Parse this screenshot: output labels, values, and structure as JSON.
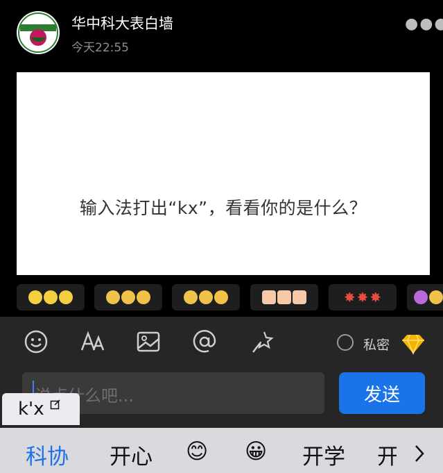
{
  "post": {
    "author": "华中科大表白墙",
    "time": "今天22:55",
    "image_text": "输入法打出“kx”，看看你的是什么？"
  },
  "reactions": [
    {
      "name": "lemon-emoji",
      "color": "#f4d03f"
    },
    {
      "name": "dizzy-face-emoji",
      "color": "#f0c24a"
    },
    {
      "name": "worried-face-emoji",
      "color": "#f0c24a"
    },
    {
      "name": "thumbs-up-emoji",
      "color": "#f6c9a8"
    },
    {
      "name": "firework-emoji",
      "color": "#e74c3c"
    },
    {
      "name": "party-emoji",
      "color": "#b96ad9"
    }
  ],
  "composer": {
    "placeholder": "说点什么吧...",
    "private_label": "私密",
    "send_label": "发送"
  },
  "ime": {
    "composition": "k'x",
    "candidates": [
      "科协",
      "开心",
      "😊",
      "😀",
      "开学",
      "开"
    ],
    "candidate_active_color": "#1a73e8"
  }
}
